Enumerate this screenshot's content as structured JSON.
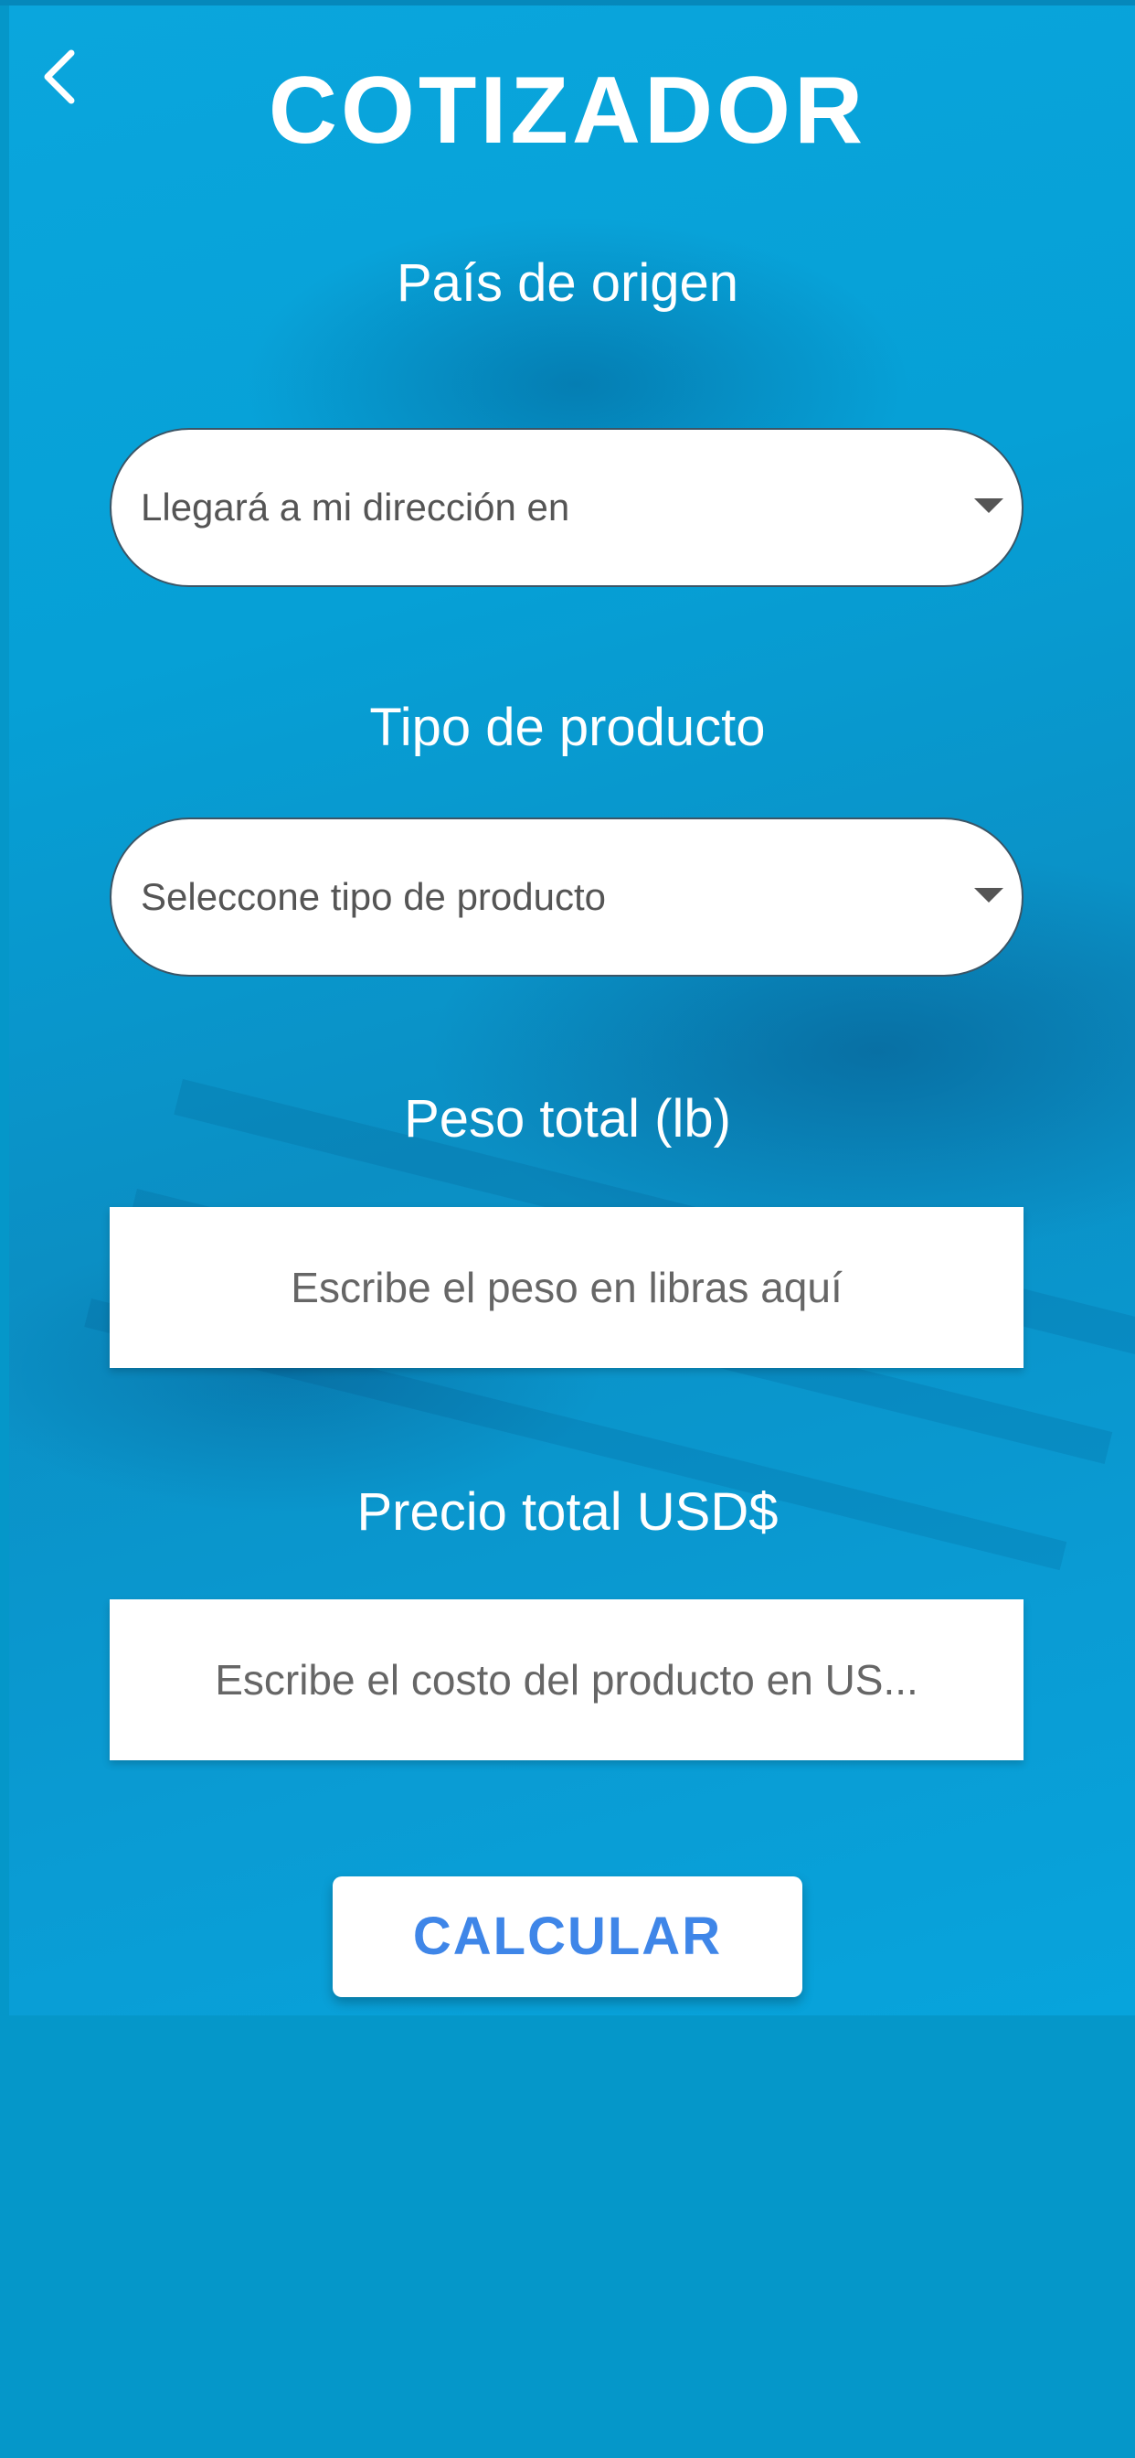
{
  "header": {
    "title": "COTIZADOR",
    "back_icon": "chevron-left-icon"
  },
  "form": {
    "origin": {
      "label": "País de origen",
      "selected": "Llegará a mi dirección en"
    },
    "product_type": {
      "label": "Tipo de producto",
      "selected": "Seleccone tipo de producto"
    },
    "weight": {
      "label": "Peso total (lb)",
      "placeholder": "Escribe el peso en libras aquí"
    },
    "price": {
      "label": "Precio total USD$",
      "placeholder": "Escribe el costo del producto en US..."
    },
    "submit_label": "CALCULAR"
  },
  "colors": {
    "background": "#0597c9",
    "accent_text": "#3f86e8",
    "field_text": "#555555"
  }
}
